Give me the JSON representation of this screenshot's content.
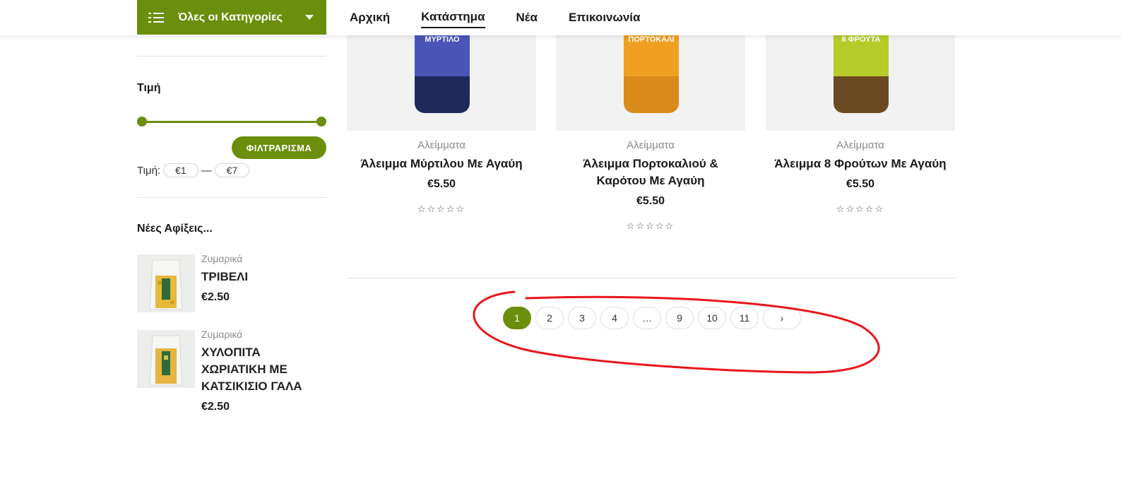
{
  "header": {
    "categories_button": "Όλες οι Κατηγορίες",
    "nav": [
      "Αρχική",
      "Κατάστημα",
      "Νέα",
      "Επικοινωνία"
    ],
    "active_nav": "Κατάστημα"
  },
  "sidebar": {
    "price_title": "Τιμή",
    "filter_button": "ΦΙΛΤΡΑΡΙΣΜΑ",
    "price_label": "Τιμή:",
    "price_min": "€1",
    "price_separator": "—",
    "price_max": "€7",
    "new_arrivals_title": "Νέες Αφίξεις...",
    "new_arrivals": [
      {
        "category": "Ζυμαρικά",
        "name": "ΤΡΙΒΕΛΙ",
        "price": "€2.50"
      },
      {
        "category": "Ζυμαρικά",
        "name": "ΧΥΛΟΠΙΤΑ ΧΩΡΙΑΤΙΚΗ ΜΕ ΚΑΤΣΙΚΙΣΙΟ ΓΑΛΑ",
        "price": "€2.50"
      }
    ]
  },
  "products": [
    {
      "category": "Αλείμματα",
      "name": "Άλειμμα Μύρτιλου Με Αγαύη",
      "price": "€5.50",
      "jar_text": "ΜΥΡΤΙΛΟ",
      "jar_color": "#4a55b8",
      "contents_color": "#1e2a5a",
      "rating": 0
    },
    {
      "category": "Αλείμματα",
      "name": "Άλειμμα Πορτοκαλιού & Καρότου Με Αγαύη",
      "price": "€5.50",
      "jar_text": "ΠΟΡΤΟΚΑΛΙ",
      "jar_color": "#f0a020",
      "contents_color": "#d98a18",
      "rating": 0
    },
    {
      "category": "Αλείμματα",
      "name": "Άλειμμα 8 Φρούτων Με Αγαύη",
      "price": "€5.50",
      "jar_text": "8 ΦΡΟΥΤΑ",
      "jar_color": "#b6cc2a",
      "contents_color": "#6b4a22",
      "rating": 0
    }
  ],
  "pagination": {
    "pages": [
      "1",
      "2",
      "3",
      "4",
      "…",
      "9",
      "10",
      "11"
    ],
    "current": "1",
    "next": "›"
  },
  "colors": {
    "accent": "#6b8e0c",
    "annotation": "#e8161c"
  }
}
